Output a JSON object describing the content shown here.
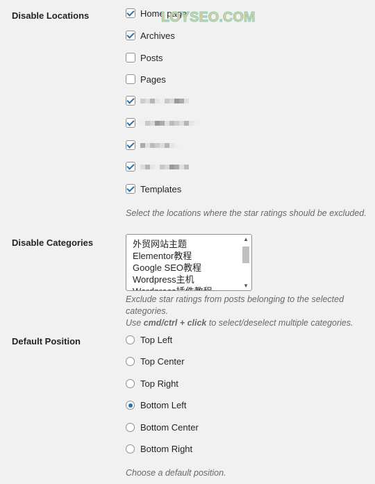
{
  "watermark": "LOYSEO.COM",
  "disable_locations": {
    "label": "Disable Locations",
    "items": [
      {
        "label": "Home page",
        "checked": true
      },
      {
        "label": "Archives",
        "checked": true
      },
      {
        "label": "Posts",
        "checked": false
      },
      {
        "label": "Pages",
        "checked": false
      },
      {
        "label": "",
        "checked": true,
        "blurred": true
      },
      {
        "label": "",
        "checked": true,
        "blurred": true
      },
      {
        "label": "",
        "checked": true,
        "blurred": true
      },
      {
        "label": "",
        "checked": true,
        "blurred": true
      },
      {
        "label": "Templates",
        "checked": true
      }
    ],
    "description": "Select the locations where the star ratings should be excluded."
  },
  "disable_categories": {
    "label": "Disable Categories",
    "options": [
      "外贸网站主题",
      "Elementor教程",
      "Google SEO教程",
      "Wordpress主机",
      "Wordpress插件教程"
    ],
    "description_1": "Exclude star ratings from posts belonging to the selected categories.",
    "description_2_pre": "Use ",
    "description_2_bold": "cmd/ctrl + click",
    "description_2_post": " to select/deselect multiple categories."
  },
  "default_position": {
    "label": "Default Position",
    "options": [
      {
        "label": "Top Left",
        "selected": false
      },
      {
        "label": "Top Center",
        "selected": false
      },
      {
        "label": "Top Right",
        "selected": false
      },
      {
        "label": "Bottom Left",
        "selected": true
      },
      {
        "label": "Bottom Center",
        "selected": false
      },
      {
        "label": "Bottom Right",
        "selected": false
      }
    ],
    "description": "Choose a default position."
  },
  "colors": {
    "accent": "#2271b1"
  }
}
